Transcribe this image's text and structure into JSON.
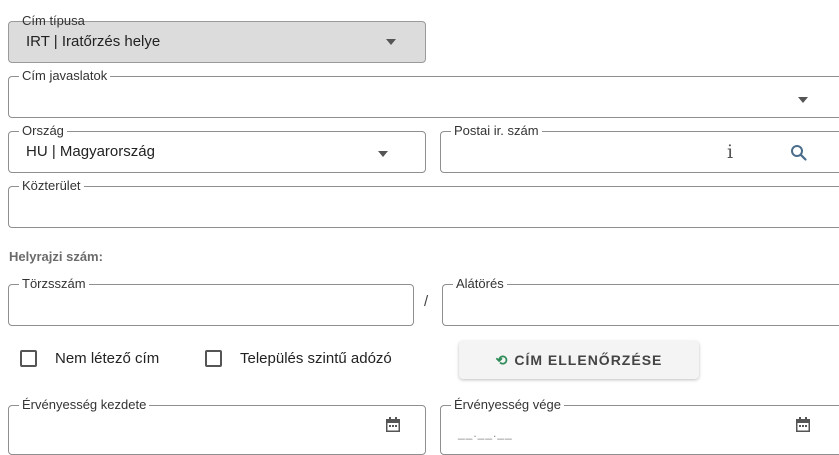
{
  "address_type": {
    "label": "Cím típusa",
    "value": "IRT | Iratőrzés helye"
  },
  "address_suggestions": {
    "label": "Cím javaslatok",
    "value": ""
  },
  "country": {
    "label": "Ország",
    "value": "HU | Magyarország"
  },
  "postal_code": {
    "label": "Postai ir. szám",
    "value": "",
    "info_icon": "i"
  },
  "street": {
    "label": "Közterület",
    "value": ""
  },
  "parcel": {
    "section_label": "Helyrajzi szám:",
    "main_number_label": "Törzsszám",
    "separator": "/",
    "sub_number_label": "Alátörés"
  },
  "checkboxes": {
    "nonexistent_address": {
      "label": "Nem létező cím",
      "checked": false
    },
    "settlement_level_taxpayer": {
      "label": "Település szintű adózó",
      "checked": false
    }
  },
  "verify_button": {
    "label": "CÍM ELLENŐRZÉSE",
    "icon": "refresh-icon",
    "icon_glyph": "⟲"
  },
  "validity_start": {
    "label": "Érvényesség kezdete",
    "value": ""
  },
  "validity_end": {
    "label": "Érvényesség vége",
    "placeholder": "__.__.__"
  },
  "colors": {
    "accent_icon": "#2e8b57",
    "disabled_bg": "#dcdcdc",
    "section_label": "#6b6b6b"
  }
}
